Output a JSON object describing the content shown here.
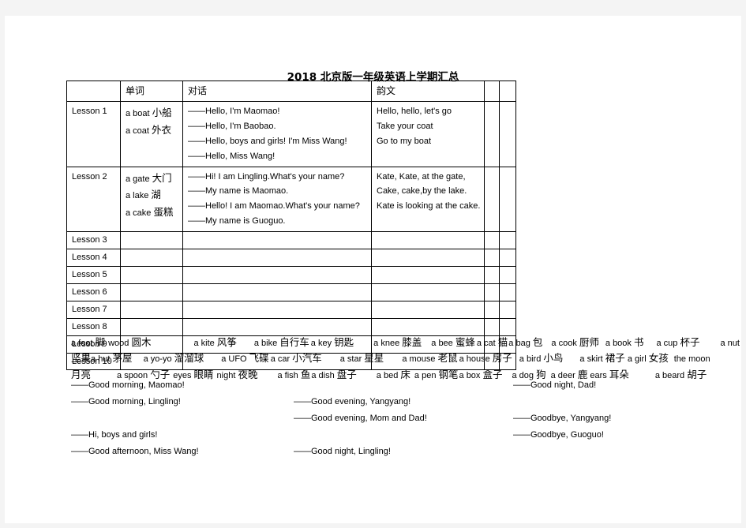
{
  "document": {
    "title": "2018 北京版一年级英语上学期汇总"
  },
  "table": {
    "headers": [
      "",
      "单词",
      "对话",
      "韵文",
      "",
      ""
    ],
    "rows": [
      {
        "lesson": "Lesson 1",
        "words": [
          "a boat  小船",
          "a coat  外衣"
        ],
        "dialog": [
          "——Hello, I'm Maomao!",
          "——Hello, I'm Baobao.",
          "——Hello, boys and girls! I'm Miss Wang!",
          "——Hello, Miss Wang!"
        ],
        "rhyme": [
          "Hello, hello, let's go",
          "Take your coat",
          "Go to my boat"
        ]
      },
      {
        "lesson": "Lesson 2",
        "words": [
          "a gate 大门",
          "a lake 湖",
          "a cake 蛋糕"
        ],
        "dialog": [
          "——Hi! I am Lingling.What's your name?",
          "——My name is Maomao.",
          "——Hello! I am Maomao.What's your name?",
          "——My name is Guoguo."
        ],
        "rhyme": [
          "Kate, Kate, at the gate,",
          "Cake, cake,by the lake.",
          "Kate is looking at the cake."
        ]
      },
      {
        "lesson": "Lesson 3",
        "words": [],
        "dialog": [],
        "rhyme": []
      },
      {
        "lesson": "Lesson 4",
        "words": [],
        "dialog": [],
        "rhyme": []
      },
      {
        "lesson": "Lesson 5",
        "words": [],
        "dialog": [],
        "rhyme": []
      },
      {
        "lesson": "Lesson 6",
        "words": [],
        "dialog": [],
        "rhyme": []
      },
      {
        "lesson": "Lesson 7",
        "words": [],
        "dialog": [],
        "rhyme": []
      },
      {
        "lesson": "Lesson 8",
        "words": [],
        "dialog": [],
        "rhyme": []
      },
      {
        "lesson": "Lesson 9",
        "words": [],
        "dialog": [],
        "rhyme": []
      },
      {
        "lesson": "Lesson 10",
        "words": [],
        "dialog": [],
        "rhyme": []
      }
    ]
  },
  "vocabulary": {
    "lines": [
      [
        {
          "en": "a foot ",
          "zh": "脚",
          "gap": 4
        },
        {
          "en": "wood ",
          "zh": "圆木",
          "gap": 54
        },
        {
          "en": "a kite ",
          "zh": "风筝",
          "gap": 22
        },
        {
          "en": "a bike ",
          "zh": "自行车",
          "gap": 2
        },
        {
          "en": "a key ",
          "zh": "钥匙",
          "gap": 25
        },
        {
          "en": "a knee ",
          "zh": "膝盖",
          "gap": 12
        },
        {
          "en": "a bee ",
          "zh": "蜜蜂",
          "gap": 2
        },
        {
          "en": "a cat ",
          "zh": "猫",
          "gap": 1
        },
        {
          "en": "a bag ",
          "zh": "包",
          "gap": 11
        },
        {
          "en": "a cook ",
          "zh": "厨师",
          "gap": 8
        },
        {
          "en": "a book ",
          "zh": "书",
          "gap": 16
        },
        {
          "en": "a cup ",
          "zh": "杯子",
          "gap": 26
        },
        {
          "en": "a nut",
          "zh": "",
          "gap": 0
        }
      ],
      [
        {
          "en": "",
          "zh": "坚果",
          "gap": 0
        },
        {
          "en": "a hut ",
          "zh": "茅屋",
          "gap": 14
        },
        {
          "en": "a yo-yo ",
          "zh": "溜溜球",
          "gap": 22
        },
        {
          "en": "a UFO ",
          "zh": "飞碟",
          "gap": 2
        },
        {
          "en": "a car ",
          "zh": "小汽车",
          "gap": 23
        },
        {
          "en": "a star ",
          "zh": "星星",
          "gap": 23
        },
        {
          "en": "a mouse ",
          "zh": "老鼠",
          "gap": 2
        },
        {
          "en": "a house ",
          "zh": "房子",
          "gap": 9
        },
        {
          "en": "a bird ",
          "zh": "小鸟",
          "gap": 21
        },
        {
          "en": "a skirt ",
          "zh": "裙子",
          "gap": 3
        },
        {
          "en": "a girl ",
          "zh": "女孩",
          "gap": 7
        },
        {
          "en": "the  moon",
          "zh": "",
          "gap": 0
        }
      ],
      [
        {
          "en": "",
          "zh": "月亮",
          "gap": 33
        },
        {
          "en": "a spoon ",
          "zh": "勺子",
          "gap": 4
        },
        {
          "en": "eyes ",
          "zh": "眼睛",
          "gap": 4
        },
        {
          "en": "night ",
          "zh": "夜晚",
          "gap": 25
        },
        {
          "en": "a fish ",
          "zh": "鱼",
          "gap": 1
        },
        {
          "en": "a dish ",
          "zh": "盘子",
          "gap": 25
        },
        {
          "en": "a bed ",
          "zh": "床",
          "gap": 5
        },
        {
          "en": "a pen ",
          "zh": "钢笔",
          "gap": 1
        },
        {
          "en": "a box ",
          "zh": "盒子",
          "gap": 12
        },
        {
          "en": "a dog ",
          "zh": "狗",
          "gap": 6
        },
        {
          "en": "a deer ",
          "zh": "鹿",
          "gap": 3
        },
        {
          "en": "ears ",
          "zh": "耳朵",
          "gap": 33
        },
        {
          "en": "a beard ",
          "zh": "胡子",
          "gap": 0
        }
      ]
    ]
  },
  "greetings": {
    "rows": [
      {
        "a": "——Good morning, Maomao!",
        "b": "",
        "c": "——Good night, Dad!"
      },
      {
        "a": "——Good morning, Lingling!",
        "b": "——Good evening, Yangyang!",
        "c": ""
      },
      {
        "a": "",
        "b": "——Good evening, Mom and Dad!",
        "c": "——Goodbye, Yangyang!"
      },
      {
        "a": "——Hi, boys and girls!",
        "b": "",
        "c": "——Goodbye, Guoguo!"
      },
      {
        "a": "——Good afternoon, Miss Wang!",
        "b": "——Good night, Lingling!",
        "c": ""
      }
    ]
  }
}
